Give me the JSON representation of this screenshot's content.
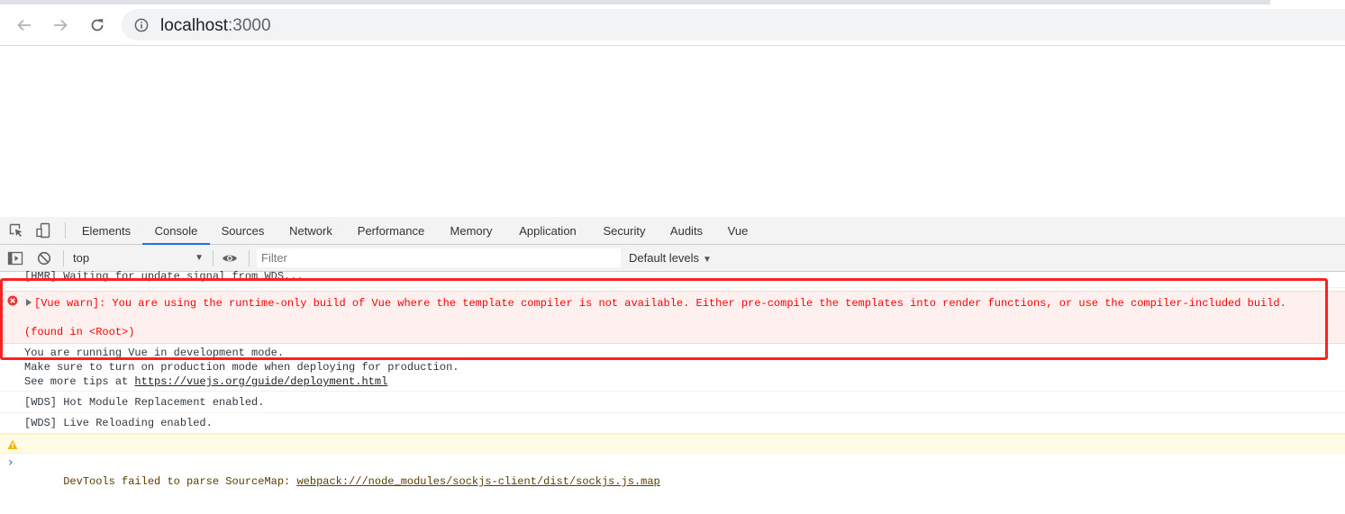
{
  "browser": {
    "url_host": "localhost",
    "url_port": ":3000",
    "icons": {
      "back": "arrow-left-icon",
      "forward": "arrow-right-icon",
      "reload": "reload-icon",
      "site_info": "info-circle-icon"
    }
  },
  "devtools": {
    "tabs": [
      {
        "label": "Elements"
      },
      {
        "label": "Console"
      },
      {
        "label": "Sources"
      },
      {
        "label": "Network"
      },
      {
        "label": "Performance"
      },
      {
        "label": "Memory"
      },
      {
        "label": "Application"
      },
      {
        "label": "Security"
      },
      {
        "label": "Audits"
      },
      {
        "label": "Vue"
      }
    ],
    "active_tab": "Console",
    "accent_color": "#1a73e8",
    "filterbar": {
      "context": "top",
      "filter_placeholder": "Filter",
      "levels": "Default levels"
    },
    "console": {
      "messages": [
        {
          "type": "log",
          "text": "[HMR] Waiting for update signal from WDS..."
        },
        {
          "type": "error",
          "text": "[Vue warn]: You are using the runtime-only build of Vue where the template compiler is not available. Either pre-compile the templates into render functions, or use the compiler-included build.",
          "found_in": "(found in <Root>)"
        },
        {
          "type": "log",
          "line1": "You are running Vue in development mode.",
          "line2": "Make sure to turn on production mode when deploying for production.",
          "line3_prefix": "See more tips at ",
          "line3_link": "https://vuejs.org/guide/deployment.html"
        },
        {
          "type": "log",
          "text": "[WDS] Hot Module Replacement enabled."
        },
        {
          "type": "log",
          "text": "[WDS] Live Reloading enabled."
        },
        {
          "type": "warning",
          "text_prefix": "DevTools failed to parse SourceMap: ",
          "link": "webpack:///node_modules/sockjs-client/dist/sockjs.js.map"
        }
      ],
      "prompt_symbol": "›"
    }
  },
  "colors": {
    "error_text": "#ff0000",
    "error_bg": "#fff0f0",
    "warn_bg": "#fffbe5",
    "highlight": "#ff2020"
  }
}
